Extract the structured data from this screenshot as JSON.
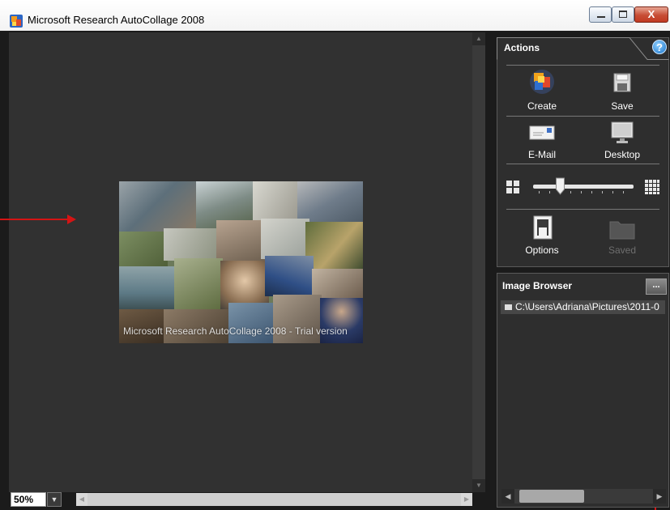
{
  "window": {
    "title": "Microsoft Research AutoCollage 2008",
    "close_glyph": "X"
  },
  "canvas": {
    "zoom": "50%",
    "zoom_dropdown_icon": "chevron-down-icon",
    "collage_watermark": "Microsoft Research AutoCollage 2008 - Trial version"
  },
  "actions": {
    "title": "Actions",
    "help_glyph": "?",
    "create_label": "Create",
    "save_label": "Save",
    "email_label": "E-Mail",
    "desktop_label": "Desktop",
    "options_label": "Options",
    "saved_label": "Saved",
    "slider_level_percent": 25
  },
  "image_browser": {
    "title": "Image Browser",
    "browse_button": "...",
    "folder_path": "C:\\Users\\Adriana\\Pictures\\2011-0"
  },
  "colors": {
    "panel_bg": "#2e2e2e",
    "canvas_bg": "#313131",
    "annotation_arrow": "#d41414"
  }
}
